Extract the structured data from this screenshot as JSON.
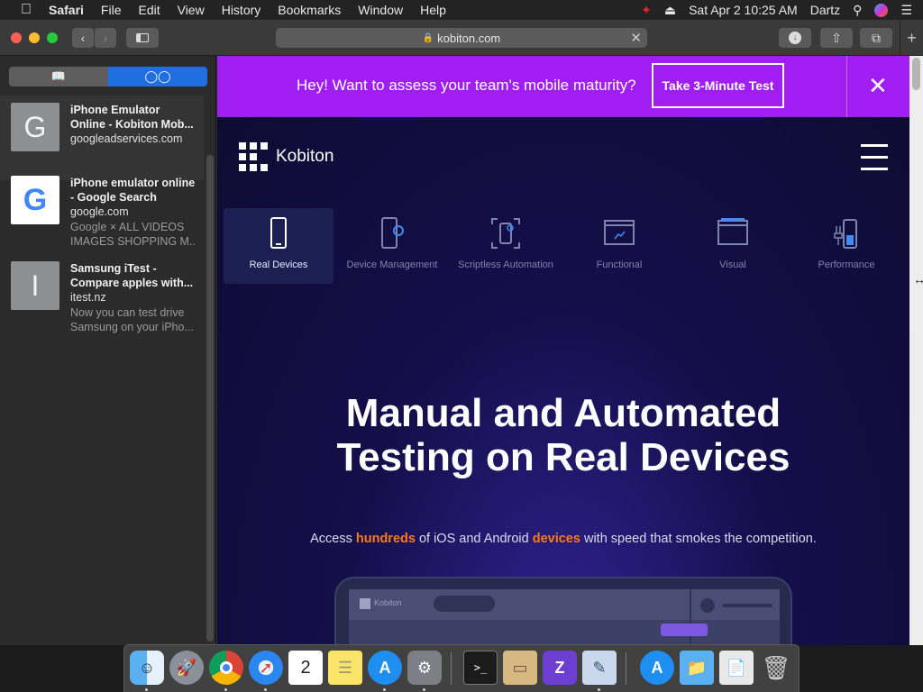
{
  "menubar": {
    "app": "Safari",
    "items": [
      "File",
      "Edit",
      "View",
      "History",
      "Bookmarks",
      "Window",
      "Help"
    ],
    "datetime": "Sat Apr 2  10:25 AM",
    "user": "Dartz"
  },
  "toolbar": {
    "address": "kobiton.com"
  },
  "sidebar": {
    "items": [
      {
        "thumb": "G",
        "title": "iPhone Emulator Online - Kobiton Mob...",
        "host": "googleadservices.com",
        "desc": ""
      },
      {
        "thumb": "G",
        "title": "iPhone emulator online - Google Search",
        "host": "google.com",
        "desc_line1": "Google × ALL VIDEOS",
        "desc_line2": "IMAGES SHOPPING M..."
      },
      {
        "thumb": "I",
        "title": "Samsung iTest - Compare apples with...",
        "host": "itest.nz",
        "desc_line1": "Now you can test drive",
        "desc_line2": "Samsung on your iPho..."
      }
    ]
  },
  "promo": {
    "text": "Hey! Want to assess your team's mobile maturity?",
    "cta": "Take 3-Minute Test",
    "close": "✕"
  },
  "site": {
    "brand": "Kobiton",
    "features": [
      {
        "label": "Real Devices",
        "icon": "smartphone-icon"
      },
      {
        "label": "Device Management",
        "icon": "device-gear-icon"
      },
      {
        "label": "Scriptless Automation",
        "icon": "scan-device-icon"
      },
      {
        "label": "Functional",
        "icon": "browser-chart-icon"
      },
      {
        "label": "Visual",
        "icon": "browser-window-icon"
      },
      {
        "label": "Performance",
        "icon": "battery-plug-icon"
      }
    ],
    "headline_1": "Manual and Automated",
    "headline_2": "Testing on Real Devices",
    "sub_1": "Access ",
    "sub_hl_1": "hundreds",
    "sub_2": " of iOS and Android ",
    "sub_hl_2": "devices",
    "sub_3": " with speed that smokes the competition.",
    "device_brand": "Kobiton"
  },
  "colors": {
    "promo_bg": "#a11ef2",
    "hero_bg": "#0f0d3a",
    "highlight": "#ff7a1a"
  }
}
